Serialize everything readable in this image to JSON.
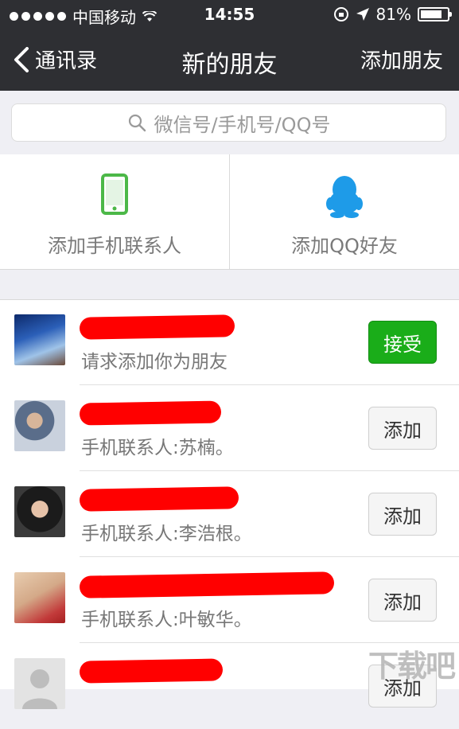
{
  "status_bar": {
    "carrier": "中国移动",
    "time": "14:55",
    "battery_percent": "81%",
    "battery_level": 0.81
  },
  "nav": {
    "back_label": "通讯录",
    "title": "新的朋友",
    "action_label": "添加朋友"
  },
  "search": {
    "placeholder": "微信号/手机号/QQ号"
  },
  "options": [
    {
      "label": "添加手机联系人",
      "icon": "phone-icon",
      "color": "#4cb848"
    },
    {
      "label": "添加QQ好友",
      "icon": "qq-penguin-icon",
      "color": "#1e9be8"
    }
  ],
  "requests": [
    {
      "subtitle": "请求添加你为朋友",
      "button": "接受",
      "status": "accept"
    },
    {
      "subtitle": "手机联系人:苏楠。",
      "button": "添加",
      "status": "add"
    },
    {
      "subtitle": "手机联系人:李浩根。",
      "button": "添加",
      "status": "add"
    },
    {
      "subtitle": "手机联系人:叶敏华。",
      "button": "添加",
      "status": "add"
    },
    {
      "subtitle": "",
      "button": "添加",
      "status": "add"
    }
  ],
  "watermark": "下载吧",
  "colors": {
    "nav_bg": "#2e2f33",
    "accept_green": "#1aad19",
    "redaction": "#ff0000"
  }
}
